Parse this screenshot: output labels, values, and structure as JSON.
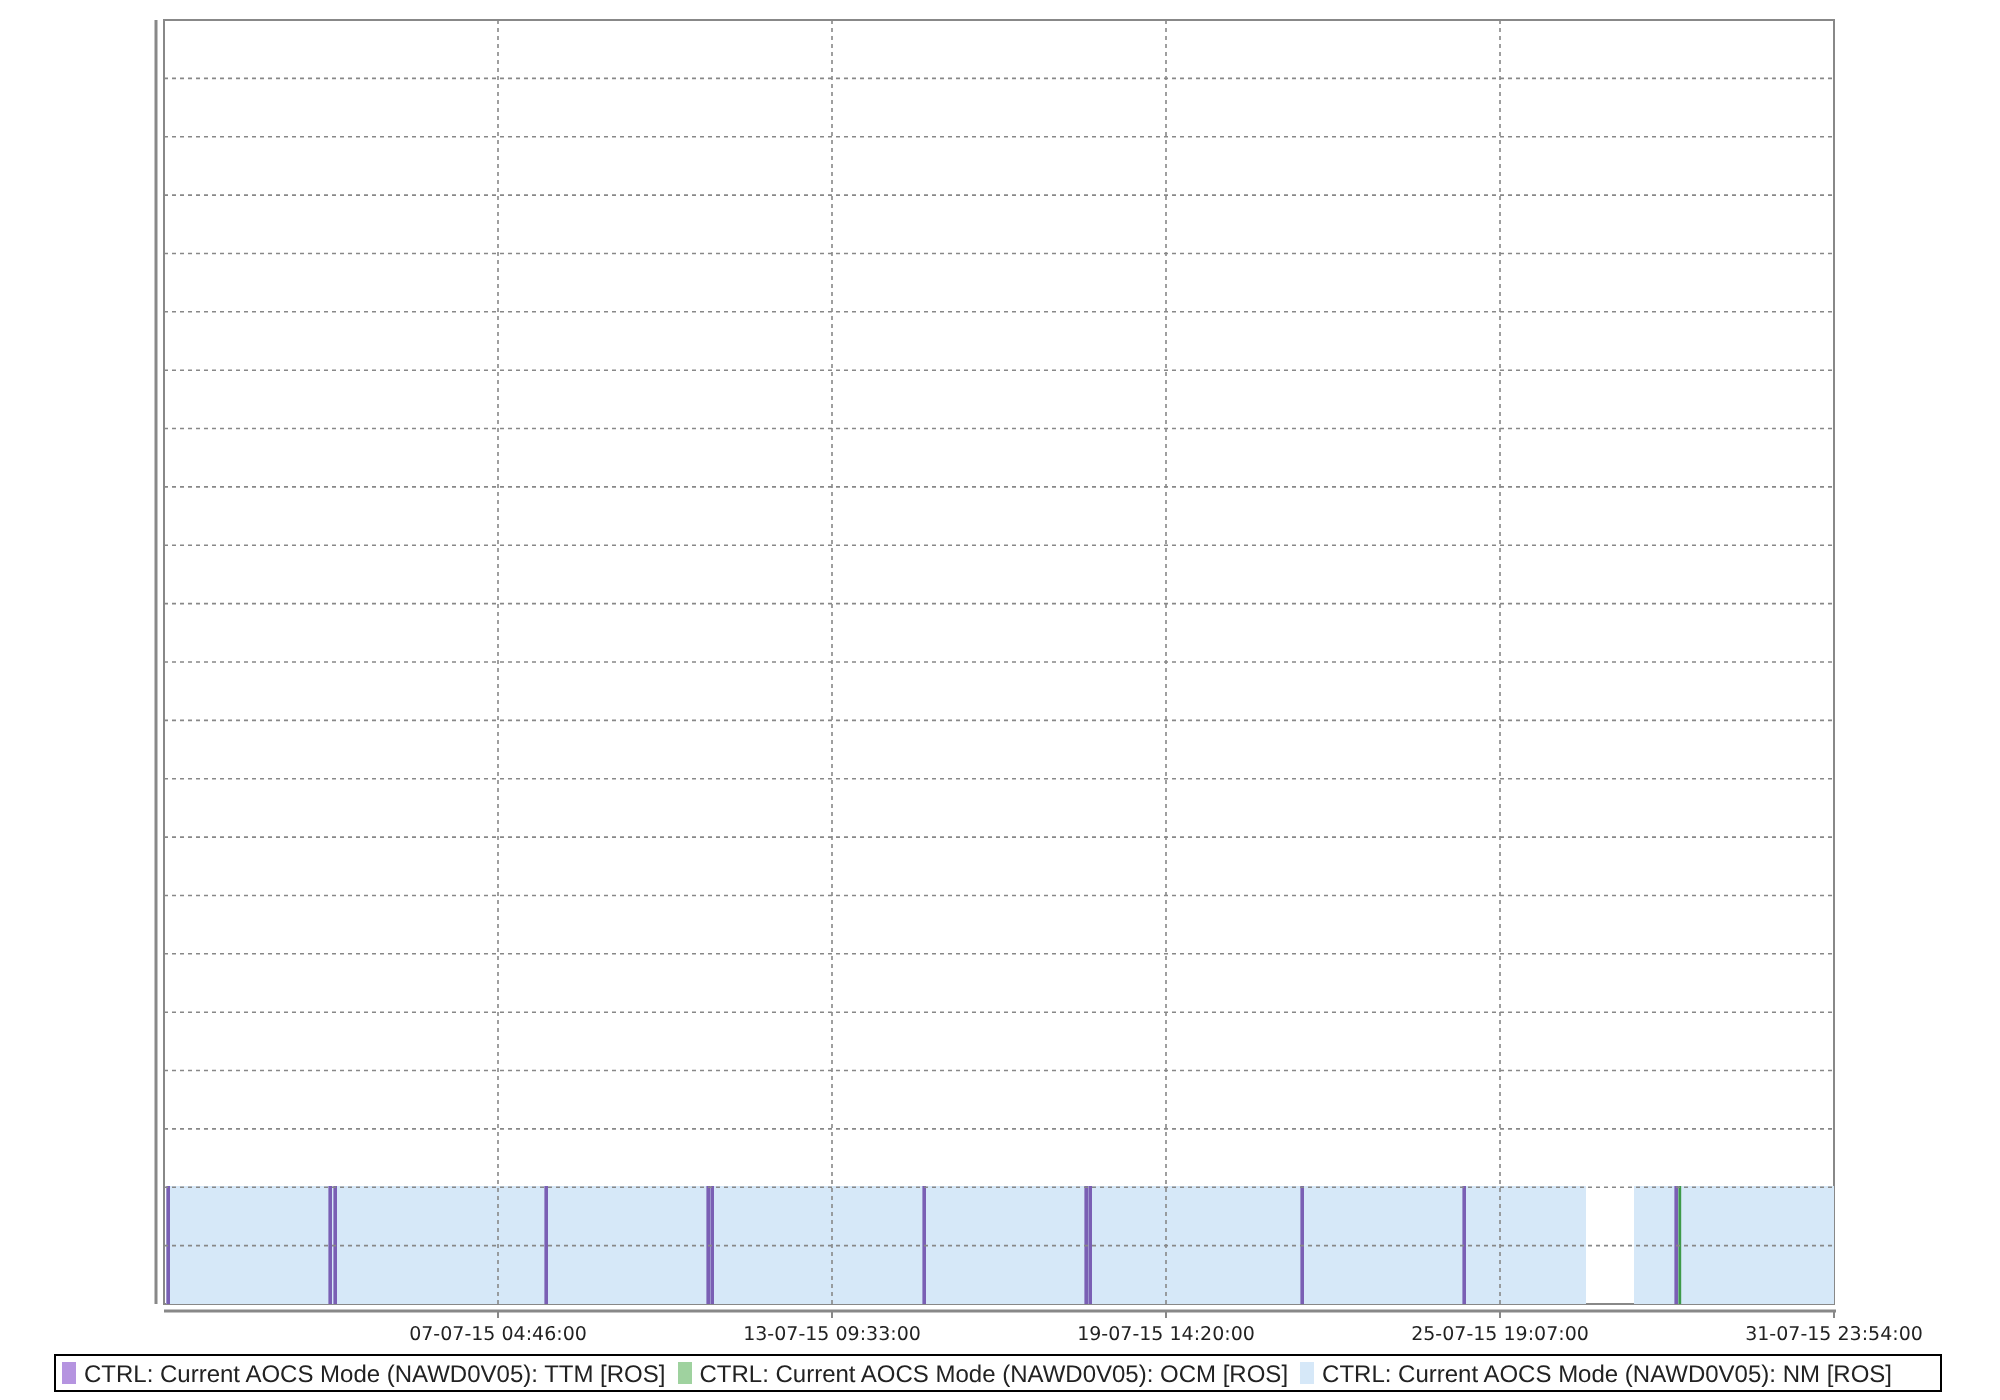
{
  "chart": {
    "x_tick_labels": [
      "07-07-15 04:46:00",
      "13-07-15 09:33:00",
      "19-07-15 14:20:00",
      "25-07-15 19:07:00",
      "31-07-15 23:54:00"
    ]
  },
  "legend": [
    {
      "label": "CTRL: Current AOCS Mode (NAWD0V05): TTM [ROS]",
      "color": "#b594e0"
    },
    {
      "label": "CTRL: Current AOCS Mode (NAWD0V05): OCM [ROS]",
      "color": "#9fd29f"
    },
    {
      "label": "CTRL: Current AOCS Mode (NAWD0V05): NM [ROS]",
      "color": "#d6e8f8"
    }
  ]
}
